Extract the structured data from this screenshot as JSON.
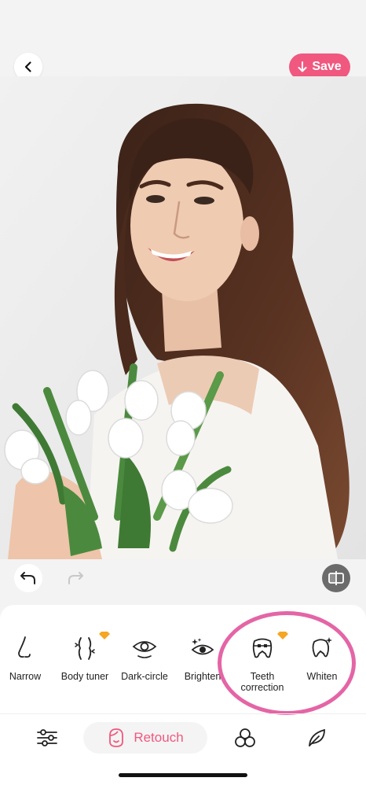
{
  "topbar": {
    "back_icon": "chevron-left-icon",
    "save_label": "Save",
    "save_icon": "arrow-down-icon"
  },
  "photo": {
    "subject": "portrait"
  },
  "controls": {
    "undo_icon": "undo-icon",
    "redo_icon": "redo-icon",
    "compare_icon": "compare-icon"
  },
  "tools": [
    {
      "label": "Narrow",
      "icon": "nose-icon",
      "pro": false
    },
    {
      "label": "Body tuner",
      "icon": "body-icon",
      "pro": true
    },
    {
      "label": "Dark-circle",
      "icon": "eye-icon",
      "pro": false
    },
    {
      "label": "Brighten",
      "icon": "sparkle-eye-icon",
      "pro": false
    },
    {
      "label": "Teeth\ncorrection",
      "icon": "braces-icon",
      "pro": true
    },
    {
      "label": "Whiten",
      "icon": "tooth-sparkle-icon",
      "pro": false
    }
  ],
  "nav": {
    "adjust_icon": "sliders-icon",
    "retouch_label": "Retouch",
    "retouch_icon": "face-icon",
    "filters_icon": "circles-icon",
    "edit_icon": "leaf-icon"
  },
  "colors": {
    "accent": "#f0587f",
    "highlight": "#e465a6",
    "pro": "#f5a623"
  }
}
